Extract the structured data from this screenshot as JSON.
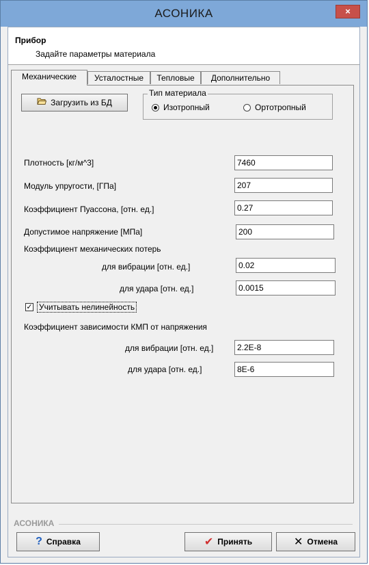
{
  "window": {
    "title": "АСОНИКА",
    "close_label": "×"
  },
  "header": {
    "title": "Прибор",
    "subtitle": "Задайте параметры материала"
  },
  "tabs": [
    {
      "label": "Механические",
      "active": true
    },
    {
      "label": "Усталостные",
      "active": false
    },
    {
      "label": "Тепловые",
      "active": false
    },
    {
      "label": "Дополнительно",
      "active": false
    }
  ],
  "load_button": {
    "label": "Загрузить из БД",
    "icon": "folder-open-icon"
  },
  "material_type": {
    "caption": "Тип материала",
    "options": [
      {
        "label": "Изотропный",
        "selected": true
      },
      {
        "label": "Ортотропный",
        "selected": false
      }
    ]
  },
  "fields": {
    "density": {
      "label": "Плотность [кг/м^3]",
      "value": "7460"
    },
    "modulus": {
      "label": "Модуль упругости, [ГПа]",
      "value": "207"
    },
    "poisson": {
      "label": "Коэффициент Пуассона, [отн. ед.]",
      "value": "0.27"
    },
    "allowable": {
      "label": "Допустимое напряжение [МПа]",
      "value": "200"
    }
  },
  "loss_coef": {
    "heading": "Коэффициент механических потерь",
    "vibration": {
      "label": "для вибрации [отн. ед.]",
      "value": "0.02"
    },
    "impact": {
      "label": "для удара [отн. ед.]",
      "value": "0.0015"
    }
  },
  "nonlinear": {
    "label": "Учитывать нелинейность",
    "checked": true,
    "check_mark": "✓"
  },
  "kmp_coef": {
    "heading": "Коэффициент зависимости КМП от напряжения",
    "vibration": {
      "label": "для вибрации [отн. ед.]",
      "value": "2.2E-8"
    },
    "impact": {
      "label": "для удара [отн. ед.]",
      "value": "8E-6"
    }
  },
  "status_label": "АСОНИКА",
  "buttons": {
    "help": {
      "label": "Справка",
      "icon": "help-question-icon",
      "glyph": "?"
    },
    "accept": {
      "label": "Принять",
      "icon": "checkmark-icon",
      "glyph": "✔"
    },
    "cancel": {
      "label": "Отмена",
      "icon": "close-x-icon",
      "glyph": "✕"
    }
  },
  "colors": {
    "titlebar": "#7ea8d8",
    "close_button": "#c7504a",
    "dialog_background": "#f0f0f0"
  }
}
